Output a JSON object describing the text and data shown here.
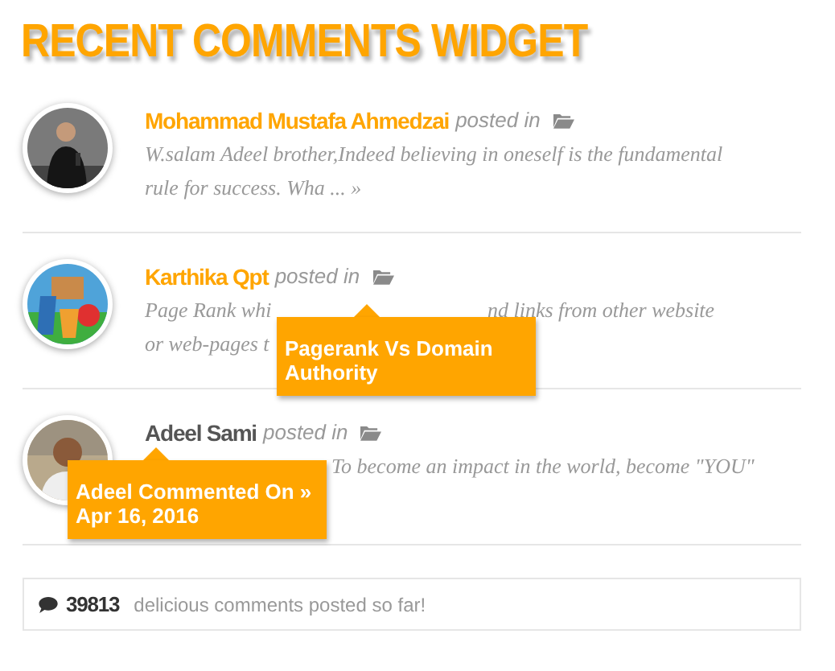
{
  "title": "RECENT COMMENTS WIDGET",
  "comments": [
    {
      "author": "Mohammad Mustafa Ahmedzai",
      "posted": "posted in",
      "hovered": false,
      "lines": [
        [
          "W.salam Adeel brother,Indeed believing in oneself is the fundamental"
        ],
        [
          "rule for success. Wha ... »"
        ]
      ]
    },
    {
      "author": "Karthika Qpt",
      "posted": "posted in",
      "hovered": false,
      "lines": [
        [
          "Page Rank whi",
          "nd links from other website"
        ],
        [
          "or web-pages t"
        ]
      ],
      "tooltip": "Pagerank Vs Domain Authority"
    },
    {
      "author": "Adeel Sami",
      "posted": "posted in",
      "hovered": true,
      "lines": [
        [
          "To become an impact in the world, become \"YOU\""
        ]
      ],
      "tooltip": "Adeel Commented On » Apr 16, 2016"
    }
  ],
  "footer": {
    "count": "39813",
    "text": "delicious comments posted so far!"
  }
}
